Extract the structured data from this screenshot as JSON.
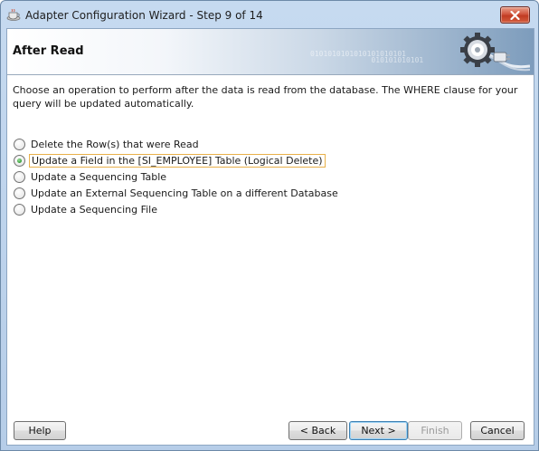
{
  "window": {
    "title": "Adapter Configuration Wizard - Step 9 of 14",
    "close_symbol": "✕"
  },
  "banner": {
    "title": "After Read",
    "binary_text": "0101010101010101010101\n010101010101",
    "graphic_icon": "gear-plug-icon"
  },
  "description": "Choose an operation to perform after the data is read from the database.  The WHERE clause for your query will be updated automatically.",
  "options": [
    {
      "label": "Delete the Row(s) that were Read",
      "selected": false
    },
    {
      "label": "Update a Field in the [SI_EMPLOYEE] Table (Logical Delete)",
      "selected": true
    },
    {
      "label": "Update a Sequencing Table",
      "selected": false
    },
    {
      "label": "Update an External Sequencing Table on a different Database",
      "selected": false
    },
    {
      "label": "Update a Sequencing File",
      "selected": false
    }
  ],
  "buttons": {
    "help": "Help",
    "back": "< Back",
    "next": "Next >",
    "finish": "Finish",
    "cancel": "Cancel"
  },
  "colors": {
    "selected_radio": "#2f9b33",
    "focus_border": "#e8b04a",
    "close_button": "#c13b22"
  }
}
